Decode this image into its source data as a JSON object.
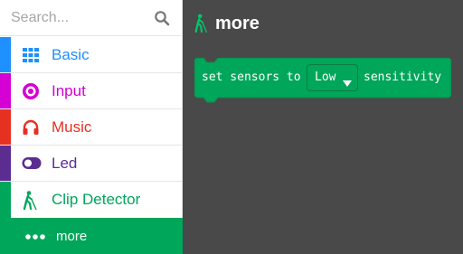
{
  "search": {
    "placeholder": "Search..."
  },
  "categories": [
    {
      "label": "Basic",
      "color": "#1e90ff",
      "icon": "grid-icon"
    },
    {
      "label": "Input",
      "color": "#d400d4",
      "icon": "target-icon"
    },
    {
      "label": "Music",
      "color": "#e63022",
      "icon": "headphones-icon"
    },
    {
      "label": "Led",
      "color": "#5c2d91",
      "icon": "toggle-icon"
    },
    {
      "label": "Clip Detector",
      "color": "#00a65a",
      "icon": "walking-person-icon"
    }
  ],
  "subcategory": {
    "label": "more",
    "color": "#00a65a",
    "icon": "more-dots-icon"
  },
  "flyout": {
    "title": "more",
    "background": "#4a4949",
    "block": {
      "prefix": "set sensors to",
      "dropdown_value": "Low",
      "suffix": "sensitivity",
      "color": "#00a65a"
    }
  }
}
